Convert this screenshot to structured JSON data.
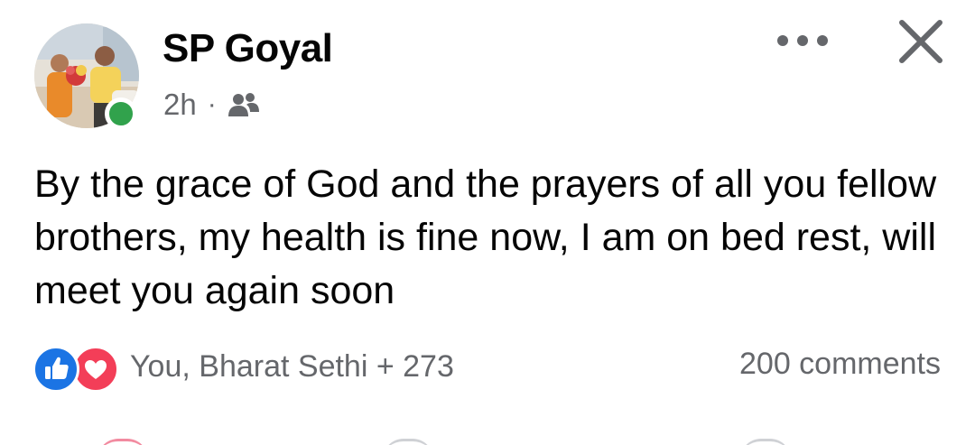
{
  "post": {
    "author": {
      "name": "SP Goyal",
      "online": true
    },
    "meta": {
      "time": "2h",
      "separator": "·",
      "audience_icon": "friends-icon"
    },
    "header_buttons": {
      "more_icon": "more-horizontal-icon",
      "close_icon": "close-icon"
    },
    "text": "By the grace of God and the prayers of all you fellow brothers, my health is fine now, I am on bed rest, will meet you again soon",
    "reactions": {
      "icons": [
        "like-icon",
        "love-icon"
      ],
      "summary": "You, Bharat Sethi + 273"
    },
    "comments": "200 comments"
  },
  "colors": {
    "online": "#31a24c",
    "like": "#1b74e4",
    "love": "#f33e58",
    "secondary_text": "#65676b",
    "primary_text": "#050505"
  }
}
